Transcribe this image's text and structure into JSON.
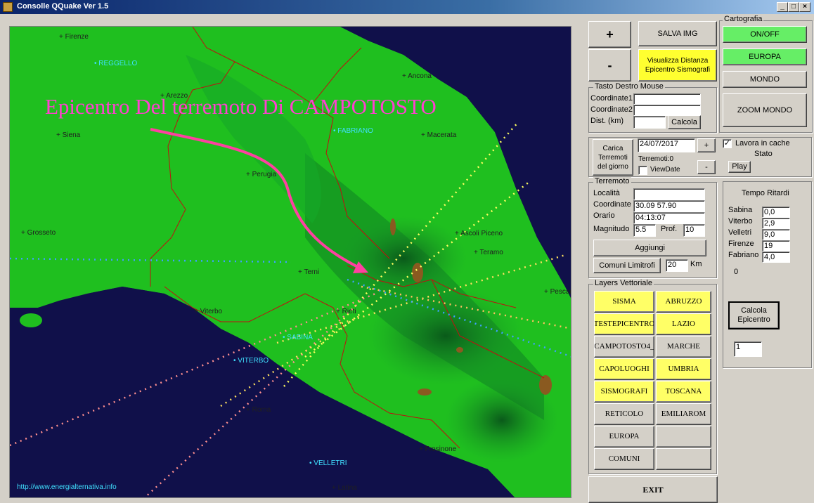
{
  "window": {
    "title": "Consolle QQuake Ver 1.5",
    "min_label": "_",
    "max_label": "□",
    "close_label": "×"
  },
  "map": {
    "annotation": "Epicentro Del terremoto Di CAMPOTOSTO",
    "url": "http://www.energialternativa.info",
    "cities": [
      "+ Firenze",
      "+ Arezzo",
      "+ Siena",
      "+ Perugia",
      "+ Grosseto",
      "+ Macerata",
      "+ Ascoli Piceno",
      "+ Teramo",
      "+ Terni",
      "+ Viterbo",
      "+ Rieti",
      "+ Roma",
      "+ Frosinone",
      "+ Latina",
      "+ Ancona",
      "+ Pescar"
    ],
    "sismografi": [
      "REGGELLO",
      "FABRIANO",
      "SABINA",
      "VITERBO",
      "VELLETRI"
    ]
  },
  "zoom": {
    "plus": "+",
    "minus": "-"
  },
  "salva_img": "SALVA IMG",
  "visualizza_distanza": "Visualizza Distanza Epicentro Sismografi",
  "cartografia": {
    "title": "Cartografia",
    "on_off": "ON/OFF",
    "europa": "EUROPA",
    "mondo": "MONDO",
    "zoom_mondo": "ZOOM MONDO"
  },
  "tasto_destro": {
    "title": "Tasto Destro Mouse",
    "coord1_label": "Coordinate1",
    "coord2_label": "Coordinate2",
    "dist_label": "Dist. (km)",
    "coord1": "",
    "coord2": "",
    "dist": "",
    "calcola": "Calcola"
  },
  "carica": {
    "button": "Carica Terremoti del giorno",
    "date": "24/07/2017",
    "plus": "+",
    "minus": "-",
    "terremoti": "Terremoti:0",
    "viewdate": "ViewDate",
    "cache_label": "Lavora in cache",
    "cache_checked": "✓",
    "stato": "Stato",
    "play": "Play"
  },
  "terremoto": {
    "title": "Terremoto",
    "localita_label": "Località",
    "localita": "",
    "coordinate_label": "Coordinate",
    "coordinate": "30.09  57.90",
    "orario_label": "Orario",
    "orario": "04:13:07",
    "magnitudo_label": "Magnitudo",
    "magnitudo": "5.5",
    "prof_label": "Prof.",
    "prof": "10",
    "aggiungi": "Aggiungi",
    "comuni_limitrofi": "Comuni Limitrofi",
    "km_value": "20",
    "km_label": "Km"
  },
  "tempo_ritardi": {
    "title": "Tempo Ritardi",
    "rows": [
      {
        "label": "Sabina",
        "value": "0,0"
      },
      {
        "label": "Viterbo",
        "value": "2,9"
      },
      {
        "label": "Velletri",
        "value": "9,0"
      },
      {
        "label": "Firenze",
        "value": "19"
      },
      {
        "label": "Fabriano",
        "value": "4,0"
      }
    ],
    "zero": "0",
    "calcola_epicentro": "Calcola Epicentro",
    "result": "1"
  },
  "layers": {
    "title": "Layers Vettoriale",
    "items": [
      "SISMA",
      "ABRUZZO",
      "TESTEPICENTRO",
      "LAZIO",
      "CAMPOTOSTO4_",
      "MARCHE",
      "CAPOLUOGHI",
      "UMBRIA",
      "SISMOGRAFI",
      "TOSCANA",
      "RETICOLO",
      "EMILIAROM",
      "EUROPA",
      "",
      "COMUNI",
      ""
    ]
  },
  "exit": "EXIT",
  "colors": {
    "sea": "#10104a",
    "land": "#1fbf1f",
    "mountain": "#0f7a22",
    "annotation": "#ff40d0",
    "sismografo_label": "#40e0ff",
    "yellow_btn": "#ffff30",
    "green_btn": "#66ee66"
  }
}
